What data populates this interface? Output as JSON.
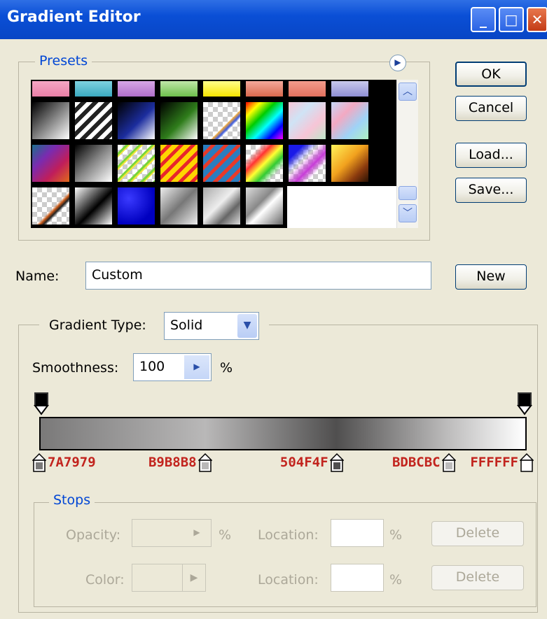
{
  "window": {
    "title": "Gradient Editor"
  },
  "presets": {
    "legend": "Presets",
    "menu_icon": "circle-arrow-icon"
  },
  "buttons": {
    "ok": "OK",
    "cancel": "Cancel",
    "load": "Load...",
    "save": "Save...",
    "new": "New"
  },
  "name_field": {
    "label": "Name:",
    "value": "Custom"
  },
  "gradient_type": {
    "label": "Gradient Type:",
    "value": "Solid"
  },
  "smoothness": {
    "label": "Smoothness:",
    "value": "100",
    "unit": "%"
  },
  "color_stops": [
    {
      "hex": "7A7979",
      "position": 0
    },
    {
      "hex": "B9B8B8",
      "position": 34
    },
    {
      "hex": "504F4F",
      "position": 61
    },
    {
      "hex": "BDBCBC",
      "position": 84
    },
    {
      "hex": "FFFFFF",
      "position": 100
    }
  ],
  "stops": {
    "legend": "Stops",
    "opacity_label": "Opacity:",
    "color_label": "Color:",
    "location_label": "Location:",
    "percent": "%",
    "delete": "Delete"
  },
  "colors": {
    "titlebar": "#0a4fd6",
    "legend": "#0046d5",
    "hex_labels": "#c2241e"
  }
}
